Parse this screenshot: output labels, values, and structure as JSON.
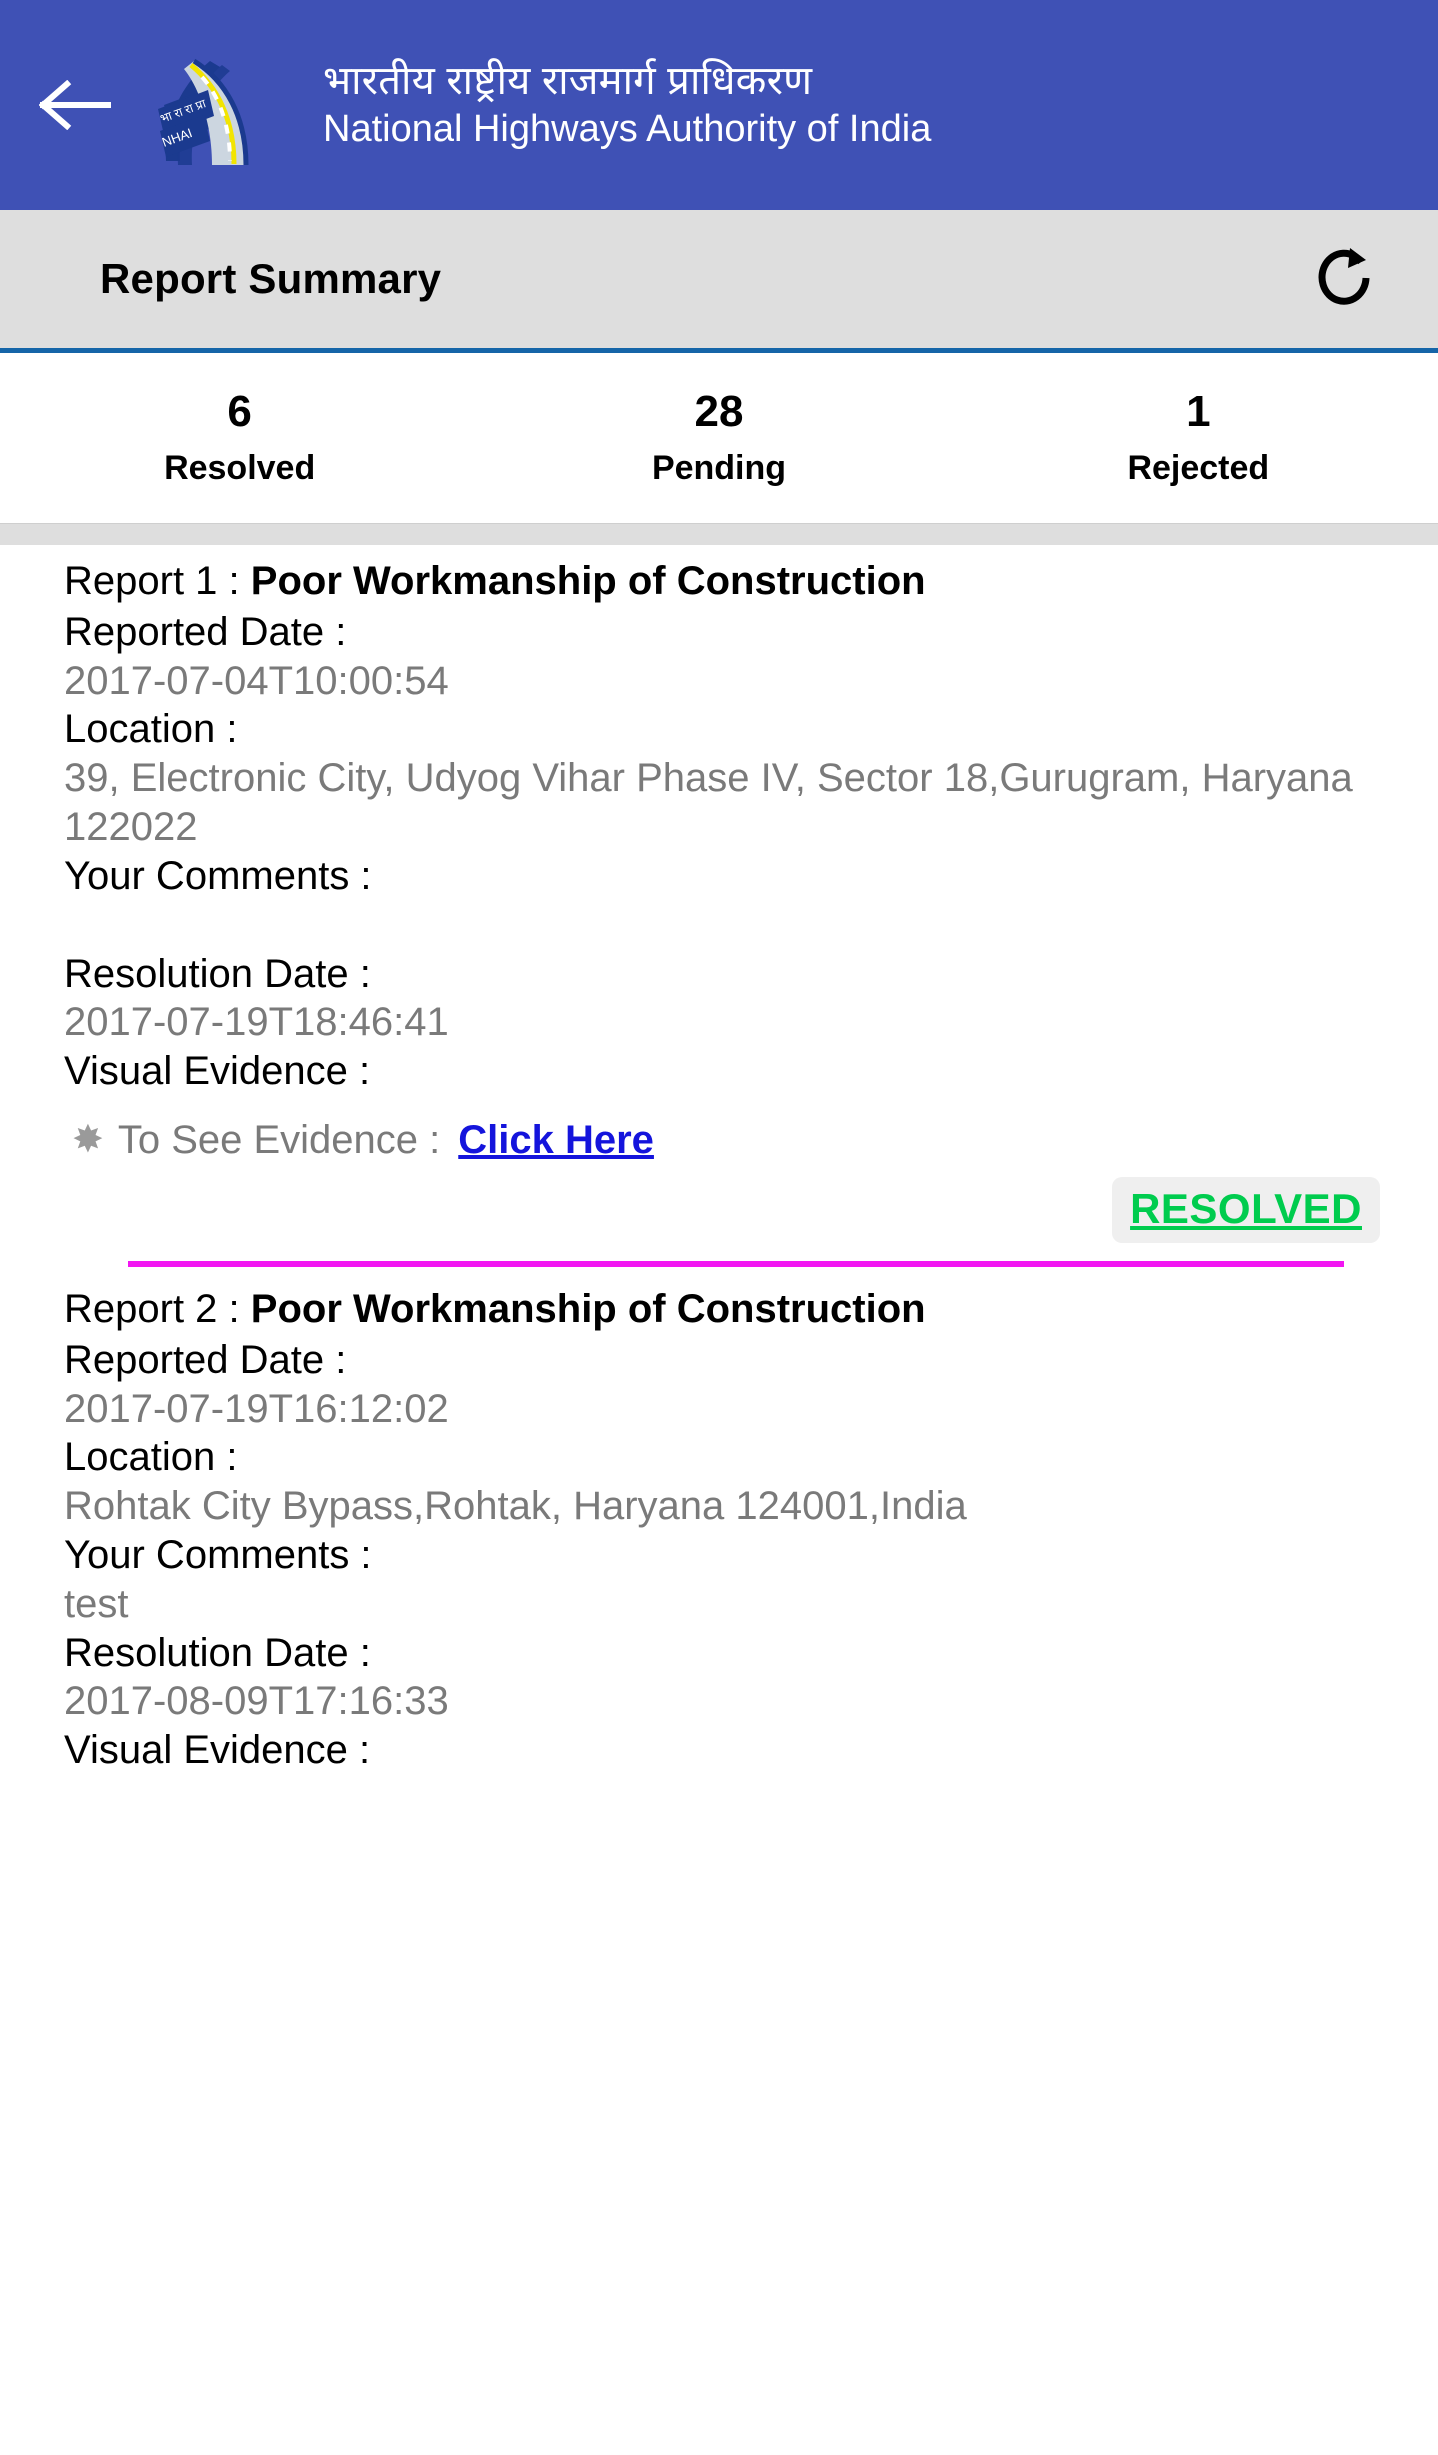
{
  "header": {
    "back_icon": "arrow-left-icon",
    "logo_icon": "nhai-logo-icon",
    "logo_sign_text": "भा रा रा प्रा",
    "logo_sign_abbr": "NHAI",
    "title_hindi": "भारतीय राष्ट्रीय राजमार्ग प्राधिकरण",
    "title_english": "National Highways Authority of India",
    "bar_color": "#3f51b5"
  },
  "subheader": {
    "title": "Report Summary",
    "refresh_icon": "refresh-icon",
    "background": "#dedede",
    "underline_color": "#1565a8"
  },
  "stats": [
    {
      "value": "6",
      "label": "Resolved"
    },
    {
      "value": "28",
      "label": "Pending"
    },
    {
      "value": "1",
      "label": "Rejected"
    }
  ],
  "labels": {
    "reported_date": "Reported Date :",
    "location": "Location :",
    "your_comments": "Your Comments :",
    "resolution_date": "Resolution Date :",
    "visual_evidence": "Visual Evidence :",
    "evidence_prefix": "To See Evidence :",
    "evidence_link": "Click Here",
    "evidence_star_icon": "star-bullet-icon"
  },
  "reports": [
    {
      "index_label": "Report 1 : ",
      "subject": "Poor Workmanship of Construction",
      "reported_date": "2017-07-04T10:00:54",
      "location": "39, Electronic City, Udyog Vihar Phase IV, Sector 18,Gurugram, Haryana 122022",
      "comments": "",
      "resolution_date": "2017-07-19T18:46:41",
      "status": "RESOLVED",
      "status_color": "#00cc4e"
    },
    {
      "index_label": "Report 2 : ",
      "subject": "Poor Workmanship of Construction",
      "reported_date": "2017-07-19T16:12:02",
      "location": "Rohtak City Bypass,Rohtak, Haryana 124001,India",
      "comments": "test",
      "resolution_date": "2017-08-09T17:16:33",
      "visual_evidence_partial": "Visual Evidence :"
    }
  ],
  "divider_color": "#f216f2"
}
